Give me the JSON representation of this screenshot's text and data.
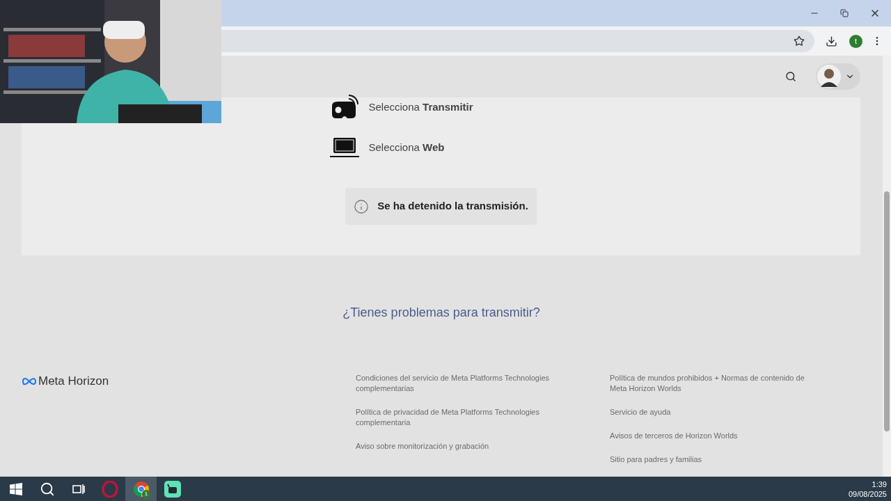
{
  "browser": {
    "profile_initial": "t"
  },
  "steps": [
    {
      "kind": "headset",
      "text": "Selecciona **Transmitir**"
    },
    {
      "kind": "laptop",
      "text": "Selecciona **Web**"
    }
  ],
  "notice": "Se ha detenido la transmisión.",
  "help_link": "¿Tienes problemas para transmitir?",
  "footer": {
    "brand": "Meta Horizon",
    "links_left": [
      "Condiciones del servicio de Meta Platforms Technologies complementarias",
      "Política de privacidad de Meta Platforms Technologies complementaria",
      "Aviso sobre monitorización y grabación"
    ],
    "links_right": [
      "Política de mundos prohibidos + Normas de contenido de Meta Horizon Worlds",
      "Servicio de ayuda",
      "Avisos de terceros de Horizon Worlds",
      "Sitio para padres y familias"
    ]
  },
  "taskbar": {
    "apps": [
      {
        "kind": "start",
        "selected": false
      },
      {
        "kind": "search",
        "selected": false
      },
      {
        "kind": "taskview",
        "selected": false
      },
      {
        "kind": "opera",
        "selected": false
      },
      {
        "kind": "chrome",
        "selected": true,
        "badge": "1"
      },
      {
        "kind": "app",
        "selected": false
      }
    ],
    "time": "1:39",
    "date": "09/08/2025"
  }
}
